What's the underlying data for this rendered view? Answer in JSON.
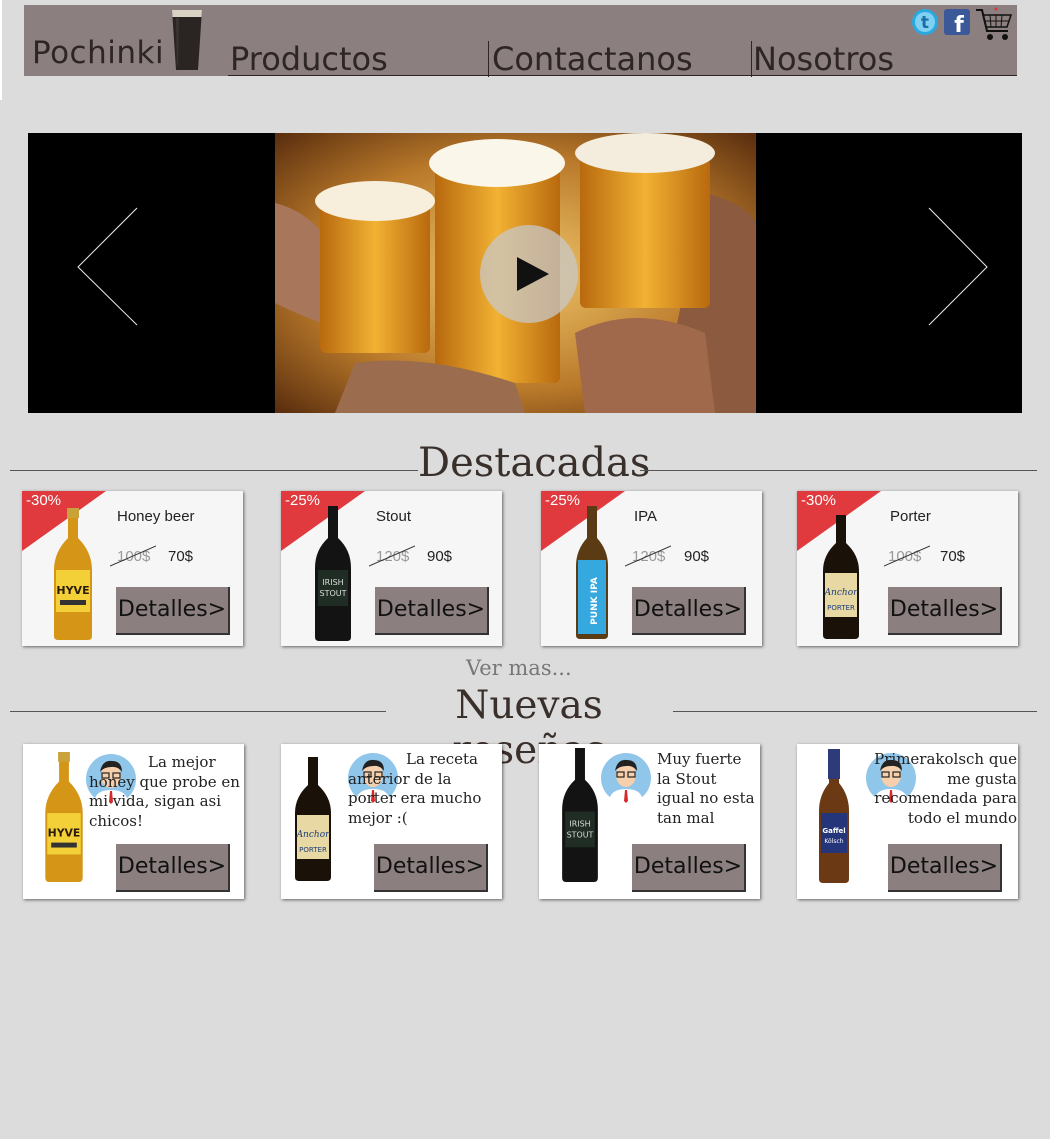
{
  "header": {
    "logo": "Pochinki",
    "nav": [
      "Productos",
      "Contactanos",
      "Nosotros"
    ]
  },
  "icons": {
    "twitter": "twitter-icon",
    "facebook": "facebook-icon",
    "cart": "cart-icon",
    "play": "play-icon",
    "prev": "chevron-left-icon",
    "next": "chevron-right-icon"
  },
  "colors": {
    "page_bg": "#dcdcdc",
    "header_bg": "#8b7f7f",
    "ribbon": "#e0393e",
    "text_dark": "#3a302b"
  },
  "sections": {
    "featured_title": "Destacadas",
    "more_link": "Ver mas...",
    "reviews_title": "Nuevas reseñas"
  },
  "featured": [
    {
      "discount": "-30%",
      "name": "Honey beer",
      "old_price": "100$",
      "new_price": "70$",
      "button": "Detalles>"
    },
    {
      "discount": "-25%",
      "name": "Stout",
      "old_price": "120$",
      "new_price": "90$",
      "button": "Detalles>"
    },
    {
      "discount": "-25%",
      "name": "IPA",
      "old_price": "120$",
      "new_price": "90$",
      "button": "Detalles>"
    },
    {
      "discount": "-30%",
      "name": "Porter",
      "old_price": "100$",
      "new_price": "70$",
      "button": "Detalles>"
    }
  ],
  "reviews": [
    {
      "text": "La mejor honey que probe en mi vida, sigan asi chicos!",
      "button": "Detalles>"
    },
    {
      "text": "La receta anterior de la porter era mucho mejor :(",
      "button": "Detalles>"
    },
    {
      "text": "Muy fuerte la Stout igual no esta tan mal",
      "button": "Detalles>"
    },
    {
      "text": "Primerakolsch que me gusta recomendada para todo el mundo",
      "button": "Detalles>"
    }
  ]
}
